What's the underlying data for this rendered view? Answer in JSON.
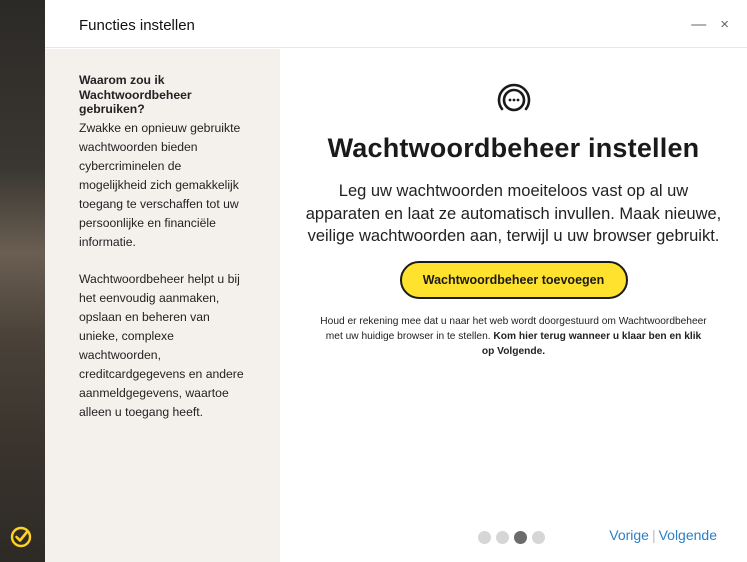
{
  "window": {
    "title": "Functies instellen",
    "minimize_glyph": "—",
    "close_glyph": "×"
  },
  "sidebar": {
    "heading": "Waarom zou ik Wachtwoordbeheer gebruiken?",
    "paragraph1": "Zwakke en opnieuw gebruikte wachtwoorden bieden cybercriminelen de mogelijkheid zich gemakkelijk toegang te verschaffen tot uw persoonlijke en financiële informatie.",
    "paragraph2": "Wachtwoordbeheer helpt u bij het eenvoudig aanmaken, opslaan en beheren van unieke, complexe wachtwoorden, creditcardgegevens en andere aanmeldgegevens, waartoe alleen u toegang heeft."
  },
  "main": {
    "icon": "password-manager-icon",
    "heading": "Wachtwoordbeheer instellen",
    "lede": "Leg uw wachtwoorden moeiteloos vast op al uw apparaten en laat ze automatisch invullen. Maak nieuwe, veilige wachtwoorden aan, terwijl u uw browser gebruikt.",
    "cta_label": "Wachtwoordbeheer toevoegen",
    "note_text": "Houd er rekening mee dat u naar het web wordt doorgestuurd om Wachtwoordbeheer met uw huidige browser in te stellen. ",
    "note_bold": "Kom hier terug wanneer u klaar ben en klik op Volgende."
  },
  "pager": {
    "total": 4,
    "current": 3
  },
  "nav": {
    "back_label": "Vorige",
    "separator": "|",
    "next_label": "Volgende"
  },
  "colors": {
    "accent_yellow": "#ffe22e",
    "link_blue": "#2a7fc9",
    "sidebar_bg": "#f4f1ed"
  }
}
